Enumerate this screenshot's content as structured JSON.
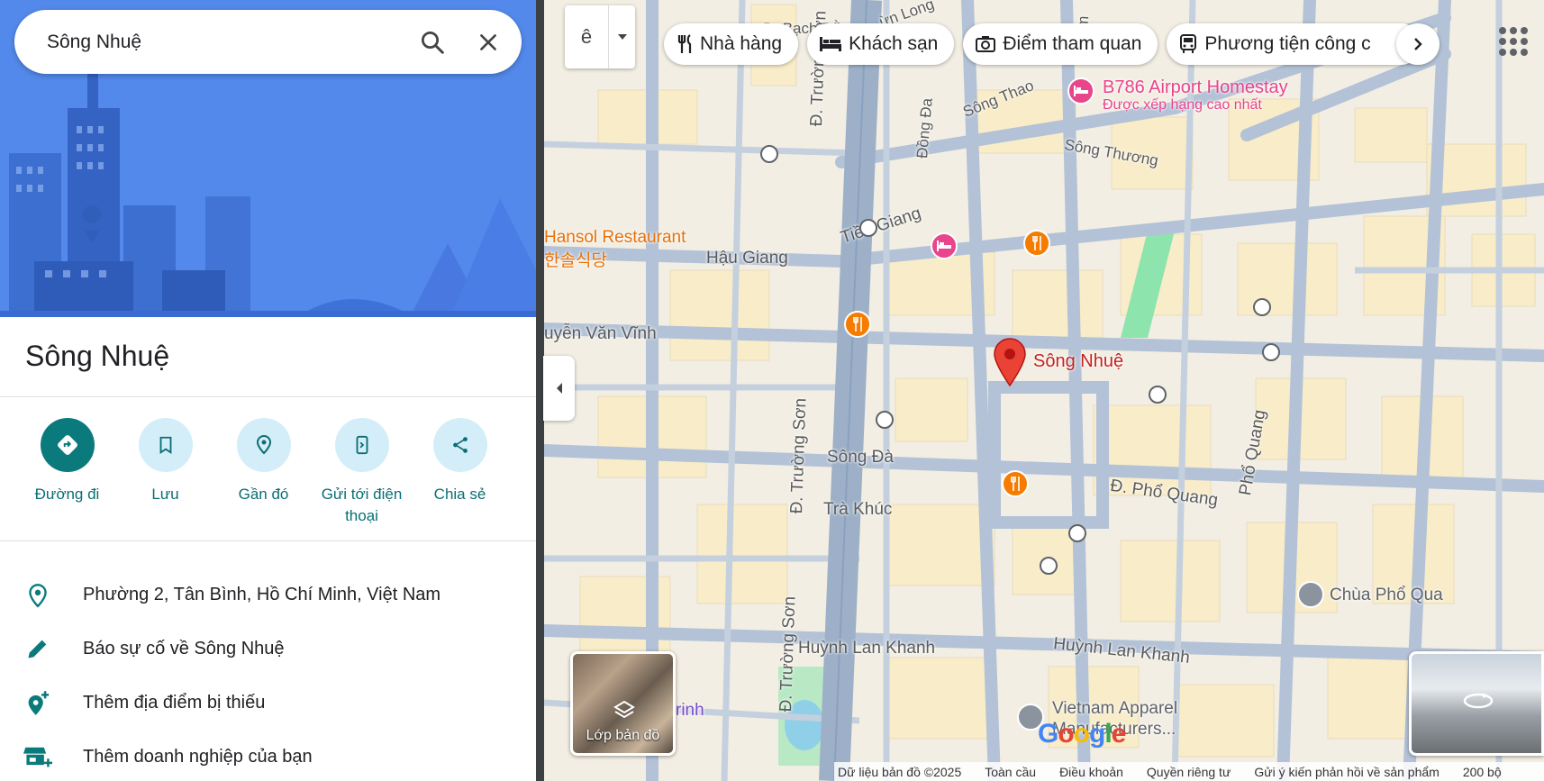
{
  "search": {
    "value": "Sông Nhuệ"
  },
  "place": {
    "title": "Sông Nhuệ",
    "actions": [
      {
        "label": "Đường đi"
      },
      {
        "label": "Lưu"
      },
      {
        "label": "Gần đó"
      },
      {
        "label": "Gửi tới điện thoại"
      },
      {
        "label": "Chia sẻ"
      }
    ],
    "info": [
      {
        "text": "Phường 2, Tân Bình, Hồ Chí Minh, Việt Nam"
      },
      {
        "text": "Báo sự cố về Sông Nhuệ"
      },
      {
        "text": "Thêm địa điểm bị thiếu"
      },
      {
        "text": "Thêm doanh nghiệp của bạn"
      }
    ]
  },
  "map": {
    "layer_toggle_glyph": "ê",
    "chips": [
      {
        "label": "Nhà hàng",
        "icon": "restaurant-icon"
      },
      {
        "label": "Khách sạn",
        "icon": "hotel-icon"
      },
      {
        "label": "Điểm tham quan",
        "icon": "camera-icon"
      },
      {
        "label": "Phương tiện công c",
        "icon": "transit-icon"
      }
    ],
    "streets": [
      "Đ. Trường Sơn",
      "Đ. Trường Sơn",
      "Đ. Trường Sơn",
      "Hậu Giang",
      "Tiền Giang",
      "Sông Thao",
      "Sông Thương",
      "Đồng Đa",
      "Sông Đà",
      "Trà Khúc",
      "Đ. Phổ Quang",
      "Phổ Quang",
      "Huỳnh Lan Khanh",
      "Huỳnh Lan Khanh",
      "uyễn Văn Vĩnh",
      "Đ. Bạch Đằng",
      "ừn Long",
      "Lam",
      "rinh"
    ],
    "pois": {
      "homestay_name": "B786 Airport Homestay",
      "homestay_sub": "Được xếp hạng cao nhất",
      "restaurant_name": "Hansol Restaurant",
      "restaurant_sub": "한솔식당",
      "pin_label": "Sông Nhuệ",
      "pagoda": "Chùa Phổ Qua",
      "apparel_1": "Vietnam Apparel",
      "apparel_2": "Manufacturers..."
    },
    "layers_label": "Lớp bản đồ",
    "google": [
      "G",
      "o",
      "o",
      "g",
      "l",
      "e"
    ],
    "google_colors": [
      "#4285f4",
      "#ea4335",
      "#fbbc05",
      "#4285f4",
      "#34a853",
      "#ea4335"
    ],
    "footer": [
      "Dữ liệu bản đồ ©2025",
      "Toàn cầu",
      "Điều khoản",
      "Quyền riêng tư",
      "Gửi ý kiến phản hồi về sản phẩm",
      "200 bộ"
    ]
  },
  "colors": {
    "accent": "#0b7a7d",
    "pin": "#ea4335",
    "hotel": "#e8458b",
    "restaurant": "#f57c00",
    "road": "#a9b8cc",
    "park": "#8ee4ad"
  }
}
